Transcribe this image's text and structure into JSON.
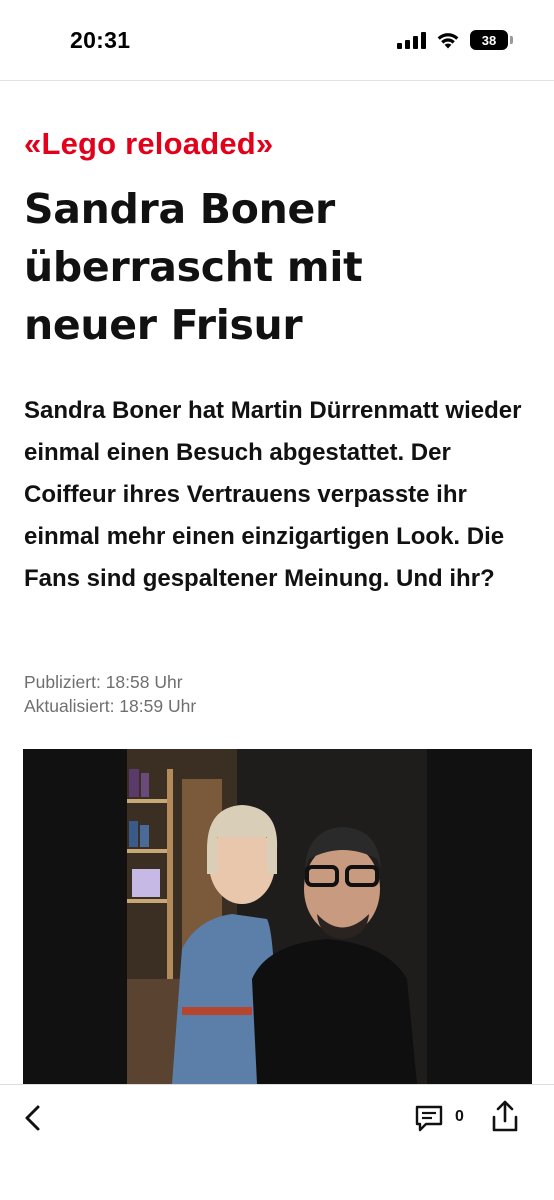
{
  "status_bar": {
    "time": "20:31",
    "battery_level": "38",
    "icons": [
      "signal-icon",
      "wifi-icon",
      "battery-icon"
    ]
  },
  "article": {
    "kicker": "«Lego reloaded»",
    "headline_lines": [
      "Sandra Boner",
      "überrascht mit",
      "neuer Frisur"
    ],
    "lead": "Sandra Boner hat Martin Dürrenmatt wieder einmal einen Besuch abgestattet. Der Coiffeur ihres Vertrauens verpasste ihr einmal mehr einen einzigartigen Look. Die Fans sind gespaltener Meinung. Und ihr?",
    "published": "Publiziert: 18:58 Uhr",
    "updated": "Aktualisiert: 18:59 Uhr"
  },
  "bottom_bar": {
    "icons": [
      "back-icon",
      "comment-icon",
      "share-icon"
    ],
    "comment_count": "0"
  },
  "colors": {
    "accent": "#e2001a",
    "text": "#111111",
    "meta": "#6f6f6f"
  }
}
